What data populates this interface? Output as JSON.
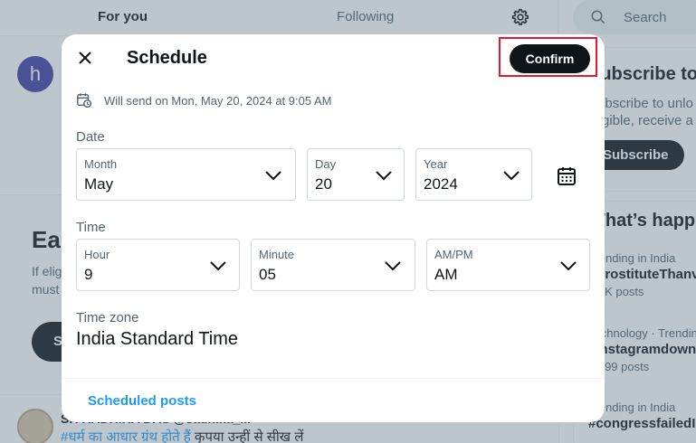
{
  "background": {
    "tabs": {
      "for_you": "For you",
      "following": "Following"
    },
    "avatar_letter": "h",
    "ea_heading": "Ea",
    "ea_text": "If elig must",
    "ea_button": "S",
    "tweet": {
      "name": "SH RADHIKA DAS @sadhika_...",
      "hashtag": "#धर्म का आधार ग्रंथ होते हैं",
      "text": " कृपया उन्हीं से सीख लें"
    },
    "search_placeholder": "Search",
    "subscribe": {
      "title": "Subscribe to",
      "text_line1": "Subscribe to unlo",
      "text_line2": "eligible, receive a",
      "button": "Subscribe"
    },
    "trends_heading": "What’s happ",
    "trends": [
      {
        "meta": "Trending in India",
        "name": "#ProstituteThanv",
        "count": "1.9K posts"
      },
      {
        "meta": "Technology · Trending",
        "name": "#instagramdown",
        "count": "5,599 posts"
      },
      {
        "meta": "Trending in India",
        "name": "#congressfailedI",
        "count": ""
      }
    ]
  },
  "modal": {
    "title": "Schedule",
    "confirm_label": "Confirm",
    "send_info": "Will send on Mon, May 20, 2024 at 9:05 AM",
    "date": {
      "section_label": "Date",
      "month": {
        "label": "Month",
        "value": "May"
      },
      "day": {
        "label": "Day",
        "value": "20"
      },
      "year": {
        "label": "Year",
        "value": "2024"
      }
    },
    "time": {
      "section_label": "Time",
      "hour": {
        "label": "Hour",
        "value": "9"
      },
      "minute": {
        "label": "Minute",
        "value": "05"
      },
      "ampm": {
        "label": "AM/PM",
        "value": "AM"
      }
    },
    "timezone": {
      "label": "Time zone",
      "value": "India Standard Time"
    },
    "scheduled_posts_link": "Scheduled posts"
  },
  "colors": {
    "accent": "#1d9bf0",
    "text_primary": "#0f1419",
    "text_secondary": "#536471",
    "highlight": "#e8192c"
  },
  "icons": [
    "close-icon",
    "calendar-clock-icon",
    "chevron-down-icon",
    "calendar-icon",
    "gear-icon",
    "search-icon"
  ]
}
